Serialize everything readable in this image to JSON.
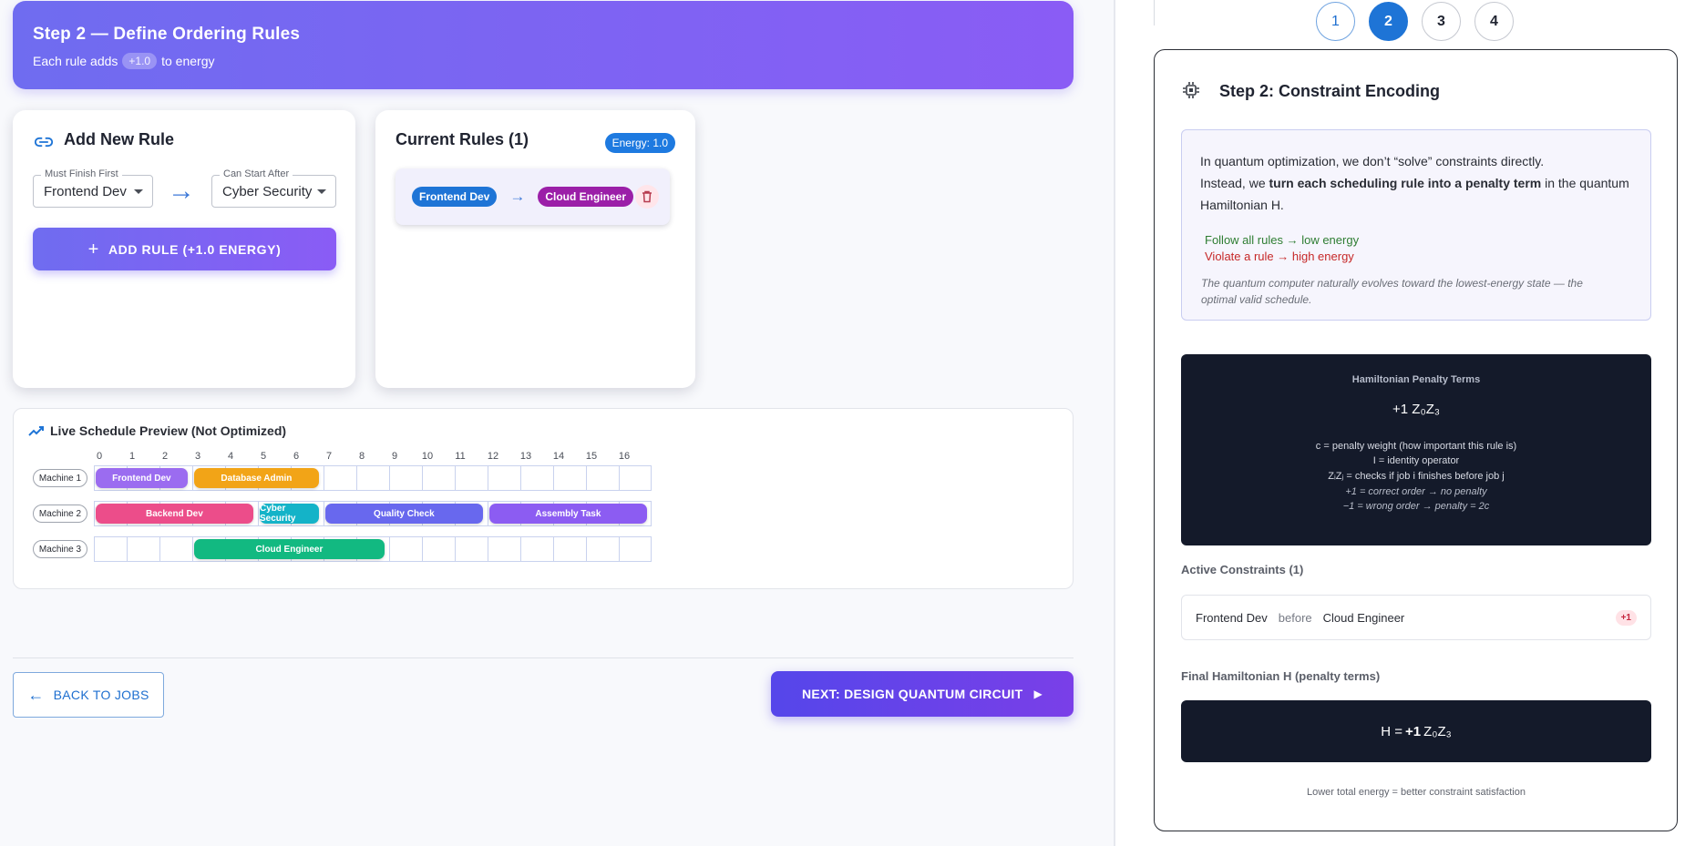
{
  "header": {
    "title": "Step 2 — Define Ordering Rules",
    "subtitle_pre": "Each rule adds",
    "energy_pill": "+1.0",
    "subtitle_post": "to energy"
  },
  "add_rule": {
    "title": "Add New Rule",
    "must_finish_label": "Must Finish First",
    "must_finish_value": "Frontend Dev",
    "can_start_label": "Can Start After",
    "can_start_value": "Cyber Security",
    "button_label": "ADD RULE (+1.0 ENERGY)"
  },
  "current_rules": {
    "title": "Current Rules (1)",
    "energy_badge": "Energy: 1.0",
    "rules": [
      {
        "from": "Frontend Dev",
        "to": "Cloud Engineer"
      }
    ]
  },
  "gantt": {
    "title": "Live Schedule Preview (Not Optimized)",
    "ticks": [
      "0",
      "1",
      "2",
      "3",
      "4",
      "5",
      "6",
      "7",
      "8",
      "9",
      "10",
      "11",
      "12",
      "13",
      "14",
      "15",
      "16"
    ],
    "machines": [
      {
        "label": "Machine 1",
        "tasks": [
          {
            "name": "Frontend Dev",
            "start": 0,
            "end": 2.8,
            "color": "#9b6cf0"
          },
          {
            "name": "Database Admin",
            "start": 3,
            "end": 6.8,
            "color": "#f2a417"
          }
        ]
      },
      {
        "label": "Machine 2",
        "tasks": [
          {
            "name": "Backend Dev",
            "start": 0,
            "end": 4.8,
            "color": "#ec4d8a"
          },
          {
            "name": "Cyber Security",
            "start": 5,
            "end": 6.8,
            "color": "#14b3c8"
          },
          {
            "name": "Quality Check",
            "start": 7,
            "end": 11.8,
            "color": "#6868ee"
          },
          {
            "name": "Assembly Task",
            "start": 12,
            "end": 16.8,
            "color": "#8c5cf2"
          }
        ]
      },
      {
        "label": "Machine 3",
        "tasks": [
          {
            "name": "Cloud Engineer",
            "start": 3,
            "end": 8.8,
            "color": "#12b981"
          }
        ]
      }
    ]
  },
  "nav": {
    "back_label": "BACK TO JOBS",
    "next_label": "NEXT: DESIGN QUANTUM CIRCUIT"
  },
  "stepper": {
    "steps": [
      "1",
      "2",
      "3",
      "4"
    ],
    "active": "2"
  },
  "panel": {
    "title": "Step 2: Constraint Encoding",
    "info_line1": "In quantum optimization, we don’t “solve” constraints directly.",
    "info_line2_pre": "Instead, we ",
    "info_line2_bold": "turn each scheduling rule into a penalty term",
    "info_line2_post": " in the quantum Hamiltonian H.",
    "follow": "Follow all rules → low energy",
    "violate": "Violate a rule → high energy",
    "italic_note": "The quantum computer naturally evolves toward the lowest-energy state — the optimal valid schedule.",
    "ham_title": "Hamiltonian Penalty Terms",
    "ham_formula": "+1 Z₀Z₃",
    "ham_c": "c = penalty weight (how important this rule is)",
    "ham_i": "I = identity operator",
    "ham_z": "ZᵢZⱼ = checks if job i finishes before job j",
    "ham_plus": "+1 = correct order → no penalty",
    "ham_minus": "−1 = wrong order → penalty = 2c",
    "active_title": "Active Constraints (1)",
    "constraint_from": "Frontend Dev",
    "constraint_before": "before",
    "constraint_to": "Cloud Engineer",
    "constraint_penalty": "+1",
    "final_title": "Final Hamiltonian H (penalty terms)",
    "final_pre": "H = ",
    "final_bold": "+1",
    "final_post": " Z₀Z₃",
    "footer": "Lower total energy = better constraint satisfaction"
  },
  "colors": {
    "accent": "#1e74d6",
    "brand_start": "#6f6cf0",
    "brand_end": "#8a5cf5"
  }
}
